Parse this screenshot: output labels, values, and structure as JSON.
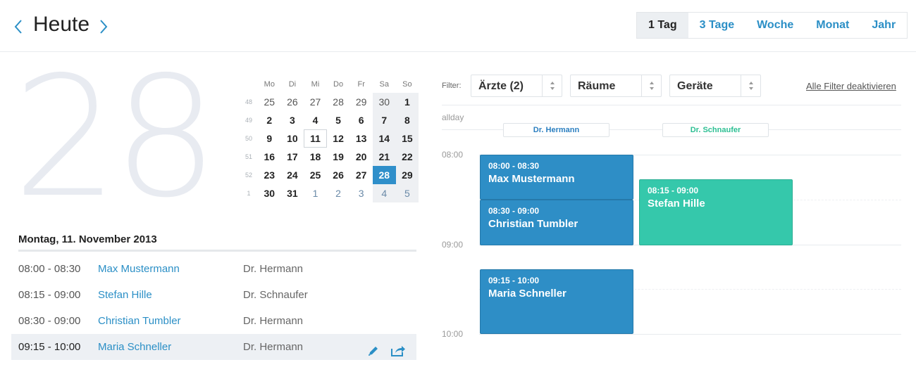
{
  "header": {
    "title": "Heute",
    "views": [
      "1 Tag",
      "3 Tage",
      "Woche",
      "Monat",
      "Jahr"
    ],
    "active_view": "1 Tag"
  },
  "big_day": "28",
  "mini_calendar": {
    "weekdays": [
      "Mo",
      "Di",
      "Mi",
      "Do",
      "Fr",
      "Sa",
      "So"
    ],
    "weeks": [
      {
        "wk": "48",
        "days": [
          "25",
          "26",
          "27",
          "28",
          "29",
          "30",
          "1"
        ]
      },
      {
        "wk": "49",
        "days": [
          "2",
          "3",
          "4",
          "5",
          "6",
          "7",
          "8"
        ]
      },
      {
        "wk": "50",
        "days": [
          "9",
          "10",
          "11",
          "12",
          "13",
          "14",
          "15"
        ]
      },
      {
        "wk": "51",
        "days": [
          "16",
          "17",
          "18",
          "19",
          "20",
          "21",
          "22"
        ]
      },
      {
        "wk": "52",
        "days": [
          "23",
          "24",
          "25",
          "26",
          "27",
          "28",
          "29"
        ]
      },
      {
        "wk": "1",
        "days": [
          "30",
          "31",
          "1",
          "2",
          "3",
          "4",
          "5"
        ]
      }
    ]
  },
  "day_list": {
    "title": "Montag, 11. November 2013",
    "items": [
      {
        "time": "08:00 - 08:30",
        "name": "Max Mustermann",
        "doctor": "Dr. Hermann"
      },
      {
        "time": "08:15 - 09:00",
        "name": "Stefan Hille",
        "doctor": "Dr. Schnaufer"
      },
      {
        "time": "08:30 - 09:00",
        "name": "Christian Tumbler",
        "doctor": "Dr. Hermann"
      },
      {
        "time": "09:15 - 10:00",
        "name": "Maria Schneller",
        "doctor": "Dr. Hermann"
      }
    ]
  },
  "filter": {
    "label": "Filter:",
    "selects": [
      "Ärzte (2)",
      "Räume",
      "Geräte"
    ],
    "reset": "Alle Filter deaktivieren"
  },
  "schedule": {
    "allday_label": "allday",
    "columns": [
      {
        "name": "Dr. Hermann",
        "color": "#2b7fc0"
      },
      {
        "name": "Dr. Schnaufer",
        "color": "#2cbf93"
      }
    ],
    "time_labels": [
      "08:00",
      "09:00",
      "10:00"
    ],
    "events": [
      {
        "time": "08:00 - 08:30",
        "name": "Max Mustermann",
        "color": "blue"
      },
      {
        "time": "08:30 - 09:00",
        "name": "Christian Tumbler",
        "color": "blue"
      },
      {
        "time": "08:15 - 09:00",
        "name": "Stefan Hille",
        "color": "green"
      },
      {
        "time": "09:15 - 10:00",
        "name": "Maria Schneller",
        "color": "blue"
      }
    ]
  },
  "colors": {
    "accent": "#2b8fc6",
    "event_blue": "#2e8ec6",
    "event_green": "#35c8ab",
    "today": "#2f8fca"
  }
}
